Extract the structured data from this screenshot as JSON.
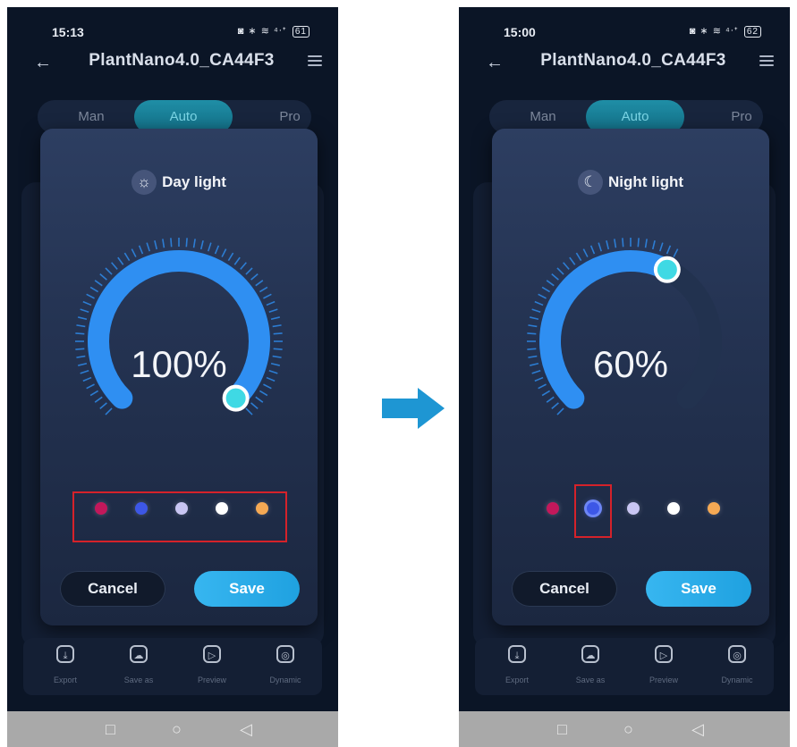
{
  "colors": {
    "arc": "#2f8ff2",
    "arc_track": "#22324f",
    "knob": "#3fd9e4",
    "highlight": "#d5222a",
    "transition_arrow": "#1e96d3"
  },
  "screens": [
    {
      "status": {
        "time": "15:13",
        "icons": "◙ ∗ ≋ ⁴ᐧᐩ",
        "battery": "61"
      },
      "app_title": "PlantNano4.0_CA44F3",
      "tabs": {
        "man": "Man",
        "auto": "Auto",
        "pro": "Pro",
        "selected": "Auto"
      },
      "modal": {
        "mode_icon": "sun-icon",
        "mode_glyph": "☼",
        "mode_label": "Day light",
        "percent_text": "100%",
        "level": 1.0,
        "color_options": [
          "#c2185b",
          "#3d57e6",
          "#c9c6f3",
          "#ffffff",
          "#f5a954"
        ],
        "highlight": "all-colors",
        "cancel_label": "Cancel",
        "save_label": "Save"
      },
      "bottom_nav": [
        {
          "label": "Export",
          "icon": "export-icon",
          "glyph": "⤓"
        },
        {
          "label": "Save as",
          "icon": "cloud-save-icon",
          "glyph": "☁"
        },
        {
          "label": "Preview",
          "icon": "play-icon",
          "glyph": "▷"
        },
        {
          "label": "Dynamic",
          "icon": "dynamic-icon",
          "glyph": "◎"
        }
      ]
    },
    {
      "status": {
        "time": "15:00",
        "icons": "◙ ∗ ≋ ⁴ᐧᐩ",
        "battery": "62"
      },
      "app_title": "PlantNano4.0_CA44F3",
      "tabs": {
        "man": "Man",
        "auto": "Auto",
        "pro": "Pro",
        "selected": "Auto"
      },
      "modal": {
        "mode_icon": "moon-icon",
        "mode_glyph": "☾",
        "mode_label": "Night light",
        "percent_text": "60%",
        "level": 0.6,
        "color_options": [
          "#c2185b",
          "#3d57e6",
          "#c9c6f3",
          "#ffffff",
          "#f5a954"
        ],
        "highlight": "blue-color",
        "selected_color": 1,
        "cancel_label": "Cancel",
        "save_label": "Save"
      },
      "bottom_nav": [
        {
          "label": "Export",
          "icon": "export-icon",
          "glyph": "⤓"
        },
        {
          "label": "Save as",
          "icon": "cloud-save-icon",
          "glyph": "☁"
        },
        {
          "label": "Preview",
          "icon": "play-icon",
          "glyph": "▷"
        },
        {
          "label": "Dynamic",
          "icon": "dynamic-icon",
          "glyph": "◎"
        }
      ]
    }
  ],
  "system_nav": {
    "recents": "□",
    "home": "○",
    "back": "◁"
  }
}
